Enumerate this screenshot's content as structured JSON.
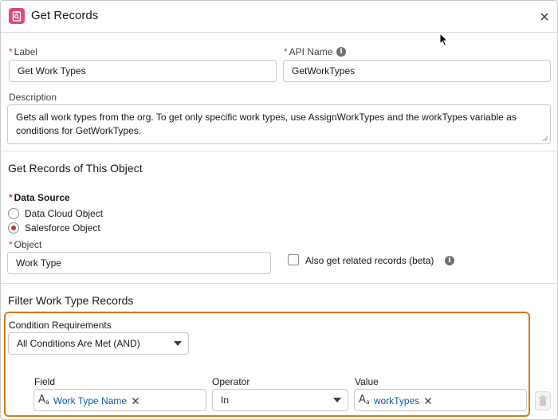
{
  "header": {
    "title": "Get Records"
  },
  "label_field": {
    "label": "Label",
    "value": "Get Work Types"
  },
  "api_name_field": {
    "label": "API Name",
    "value": "GetWorkTypes"
  },
  "description": {
    "label": "Description",
    "value": "Gets all work types from the org. To get only specific work types, use AssignWorkTypes and the workTypes variable as conditions for GetWorkTypes."
  },
  "object_section": {
    "title": "Get Records of This Object",
    "data_source_label": "Data Source",
    "options": [
      {
        "label": "Data Cloud Object",
        "checked": false
      },
      {
        "label": "Salesforce Object",
        "checked": true
      }
    ],
    "object_label": "Object",
    "object_value": "Work Type",
    "related_checkbox_label": "Also get related records (beta)",
    "related_checked": false
  },
  "filter_section": {
    "title": "Filter Work Type Records",
    "condition_label": "Condition Requirements",
    "condition_value": "All Conditions Are Met (AND)",
    "columns": {
      "field": "Field",
      "operator": "Operator",
      "value": "Value"
    },
    "row": {
      "field": "Work Type Name",
      "operator": "In",
      "value": "workTypes"
    }
  },
  "colors": {
    "accent": "#e3487d",
    "required": "#c23934",
    "highlight": "#d47b1e",
    "link": "#0b5cab"
  },
  "icons": [
    "clipboard-icon",
    "close-icon",
    "info-icon",
    "text-type-icon",
    "clear-icon",
    "chevron-down-icon",
    "trash-icon",
    "cursor-icon"
  ]
}
